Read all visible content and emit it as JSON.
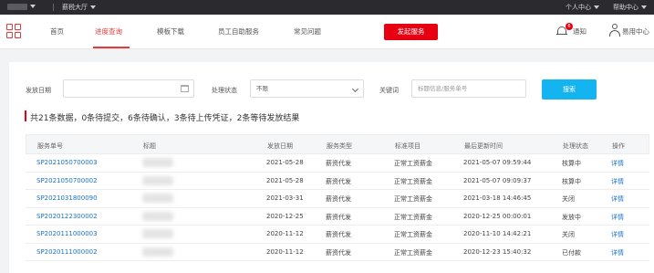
{
  "topbar": {
    "brand": "▾",
    "location": "薪税大厅",
    "personal_center": "个人中心",
    "help_center": "帮助中心"
  },
  "nav": {
    "items": [
      "首页",
      "进度查询",
      "模板下载",
      "员工自助服务",
      "常见问题"
    ],
    "cta": "发起服务",
    "notice": "通知",
    "notice_badge": "6",
    "user": "易用中心"
  },
  "filters": {
    "date_label": "发放日期",
    "date_value": "",
    "status_label": "处理状态",
    "status_value": "不限",
    "keyword_label": "关键词",
    "keyword_placeholder": "标题信息/服务单号",
    "search_label": "搜索"
  },
  "summary": "共21条数据，0条待提交，6条待确认，3条待上传凭证，2条等待发放结果",
  "table": {
    "headers": [
      "服务单号",
      "标题",
      "发放日期",
      "服务类型",
      "标准项目",
      "最后更新时间",
      "处理状态",
      "操作"
    ],
    "rows": [
      {
        "id": "SP2021050700003",
        "date": "2021-05-28",
        "type": "薪资代发",
        "item": "正常工资薪金",
        "updated": "2021-05-07 09:59:44",
        "status": "核算中",
        "action": "详情"
      },
      {
        "id": "SP2021050700002",
        "date": "2021-05-28",
        "type": "薪资代发",
        "item": "正常工资薪金",
        "updated": "2021-05-07 09:09:37",
        "status": "核算中",
        "action": "详情"
      },
      {
        "id": "SP2021031800090",
        "date": "2021-03-31",
        "type": "薪资代发",
        "item": "正常工资薪金",
        "updated": "2021-03-18 14:46:45",
        "status": "关闭",
        "action": "详情"
      },
      {
        "id": "SP2020122300002",
        "date": "2020-12-25",
        "type": "薪资代发",
        "item": "正常工资薪金",
        "updated": "2020-12-25 00:00:01",
        "status": "发放中",
        "action": "详情"
      },
      {
        "id": "SP2020111000003",
        "date": "2020-11-12",
        "type": "薪资代发",
        "item": "正常工资薪金",
        "updated": "2020-11-10 14:42:21",
        "status": "关闭",
        "action": "详情"
      },
      {
        "id": "SP2020111000002",
        "date": "2020-11-12",
        "type": "薪资代发",
        "item": "正常工资薪金",
        "updated": "2020-12-23 15:40:32",
        "status": "已付款",
        "action": "详情"
      }
    ]
  },
  "colors": {
    "accent": "#e60012",
    "link": "#1a73c8",
    "search": "#14b4f0"
  }
}
